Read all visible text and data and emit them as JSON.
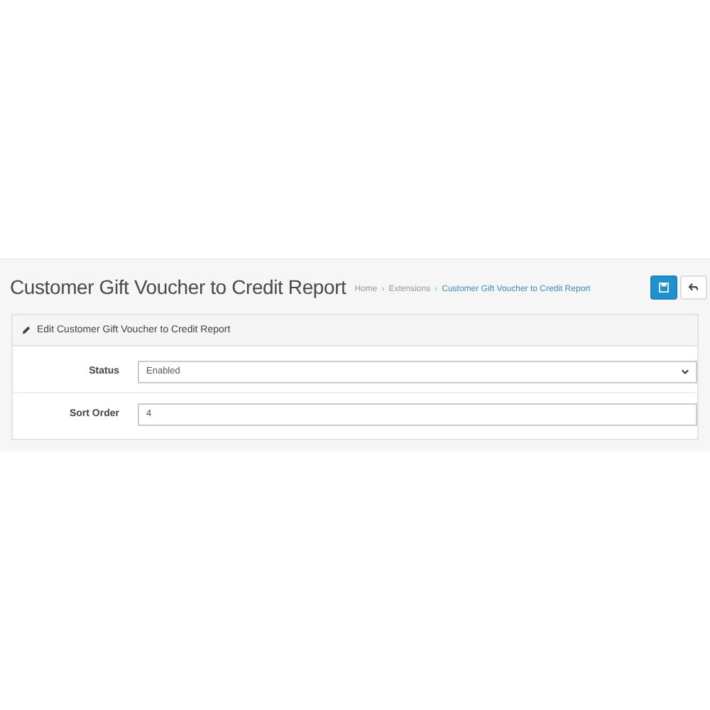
{
  "page_header": {
    "title": "Customer Gift Voucher to Credit Report",
    "breadcrumb": [
      {
        "label": "Home",
        "selected": false
      },
      {
        "separator": "›",
        "label": "Extensions",
        "selected": false
      },
      {
        "separator": "›",
        "label": "Customer Gift Voucher to Credit Report",
        "selected": true
      }
    ]
  },
  "panel": {
    "title": "Edit Customer Gift Voucher to Credit Report",
    "fields": [
      {
        "kind": "select",
        "label": "Status",
        "value": "Enabled"
      },
      {
        "kind": "text",
        "label": "Sort Order",
        "value": "4"
      }
    ]
  }
}
